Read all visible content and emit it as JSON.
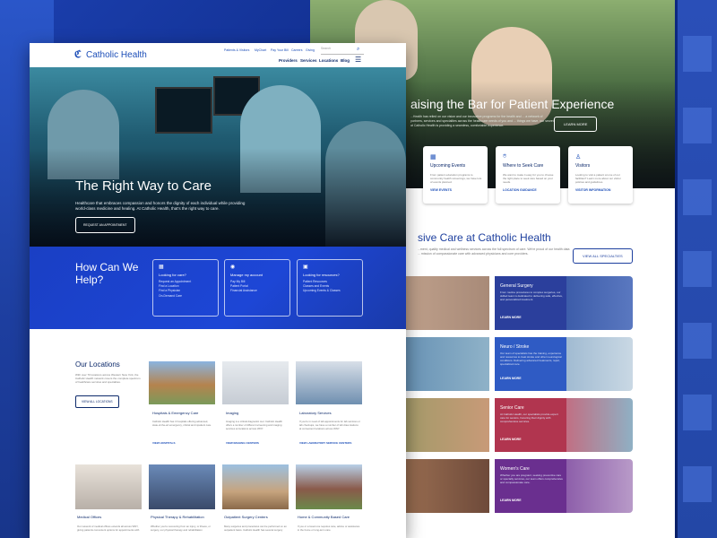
{
  "front": {
    "brand": {
      "name": "Catholic Health",
      "logo_icon": "cross-logo-icon"
    },
    "utility_nav": [
      "Patients & Visitors",
      "MyChart",
      "Pay Your Bill",
      "Careers",
      "Giving"
    ],
    "search": {
      "placeholder": "Search"
    },
    "main_nav": [
      "Providers",
      "Services",
      "Locations",
      "Blog"
    ],
    "hero": {
      "title": "The Right Way to Care",
      "text": "Healthcare that embraces compassion and honors the dignity of each individual while providing world-class medicine and healing. At Catholic Health, that's the right way to care.",
      "button": "REQUEST AN APPOINTMENT"
    },
    "help": {
      "title": "How Can We Help?",
      "cards": [
        {
          "icon": "calendar-icon",
          "title": "Looking for care?",
          "items": [
            "Request an Appointment",
            "Find a Location",
            "Find a Physician",
            "On-Demand Care"
          ]
        },
        {
          "icon": "user-circle-icon",
          "title": "Manage my account",
          "items": [
            "Pay My Bill",
            "Patient Portal",
            "Financial Assistance"
          ]
        },
        {
          "icon": "book-icon",
          "title": "Looking for resources?",
          "items": [
            "Patient Resources",
            "Classes and Events",
            "Upcoming Events & Classes"
          ]
        }
      ]
    },
    "locations": {
      "title": "Our Locations",
      "text": "With over 70 locations across Western New York, the Catholic Health network covers the complete spectrum of healthcare services and specialties.",
      "button": "VIEW ALL LOCATIONS",
      "tiles": [
        {
          "title": "Hospitals & Emergency Care",
          "desc": "Catholic Health has 4 hospitals offering advanced, state-of-the-art emergency, critical and inpatient care.",
          "link": "VIEW HOSPITALS"
        },
        {
          "title": "Imaging",
          "desc": "Imaging is a critical diagnostic tool. Catholic Health offers a number of different screening and imaging services at locations across WNY.",
          "link": "VIEW IMAGING CENTERS"
        },
        {
          "title": "Laboratory Services",
          "desc": "If you're in need of lab appointments for lab services or lab checkups, we have a number of lab draw stations at convenient locations across WNY.",
          "link": "VIEW LABORATORY SERVICE CENTERS"
        }
      ],
      "tiles2": [
        {
          "title": "Medical Offices",
          "desc": "Our network of medical offices extends all across WNY, giving patients convenient options for appointments with"
        },
        {
          "title": "Physical Therapy & Rehabilitation",
          "desc": "Whether you're recovering from an injury, or illness, or surgery, our physical therapy and rehabilitation"
        },
        {
          "title": "Outpatient Surgery Centers",
          "desc": "Many surgeries and procedures can be performed on an outpatient basis. Catholic Health has several surgery"
        },
        {
          "title": "Home & Community Based Care",
          "desc": "If you or a loved one requires care, advice or assistance in the home or long-term care"
        }
      ]
    }
  },
  "back": {
    "hero_title": "aising the Bar for Patient Experience",
    "hero_text": "...Health has relied on our vision and our innovative programs for the health and ... a network of partners, services and specialties across the healthcare needs of you and ... things we have, our secret at Catholic Health is providing a seamless, comfortable experience.",
    "hero_button": "LEARN MORE",
    "cards": [
      {
        "icon": "calendar-icon",
        "title": "Upcoming Events",
        "desc": "From patient education programs to community health screenings, we have lots of events planned.",
        "link": "VIEW EVENTS"
      },
      {
        "icon": "map-pin-icon",
        "title": "Where to Seek Care",
        "desc": "We want to make it easy for you to choose the right place to seek care based on your needs.",
        "link": "LOCATION GUIDANCE"
      },
      {
        "icon": "person-icon",
        "title": "Visitors",
        "desc": "Looking to visit a patient at one of our facilities? Learn more about our visitor policies and guidelines.",
        "link": "VISITOR INFORMATION"
      }
    ],
    "section_title": "sive Care at Catholic Health",
    "section_text": "...ment, quality medical and wellness services across the full spectrum of care. We're proud of our health data ... mission of compassionate care with advanced physicians and core providers.",
    "section_button": "VIEW ALL SPECIALTIES",
    "services": [
      {
        "title": "General Surgery",
        "desc": "From routine procedures to complex surgeries, our skilled team is dedicated to delivering safe, effective, and personalized treatment.",
        "link": "LEARN MORE",
        "color": "#2b3f9c"
      },
      {
        "title": "Neuro / Stroke",
        "desc": "Our team of specialists has the training, experience and resources to treat stroke and other neurological conditions. Delivering advanced treatments, rapid, specialized care.",
        "link": "LEARN MORE",
        "color": "#2f5bc4"
      },
      {
        "title": "Senior Care",
        "desc": "At Catholic Health, our specialists provide expert care for seniors, honoring their dignity with comprehensive services.",
        "link": "LEARN MORE",
        "color": "#b1354f"
      },
      {
        "title": "Women's Care",
        "desc": "Whether you are pregnant, seeking preventive care or specialty services, our team offers comprehensive and compassionate care.",
        "link": "LEARN MORE",
        "color": "#6a2f8f"
      }
    ]
  }
}
